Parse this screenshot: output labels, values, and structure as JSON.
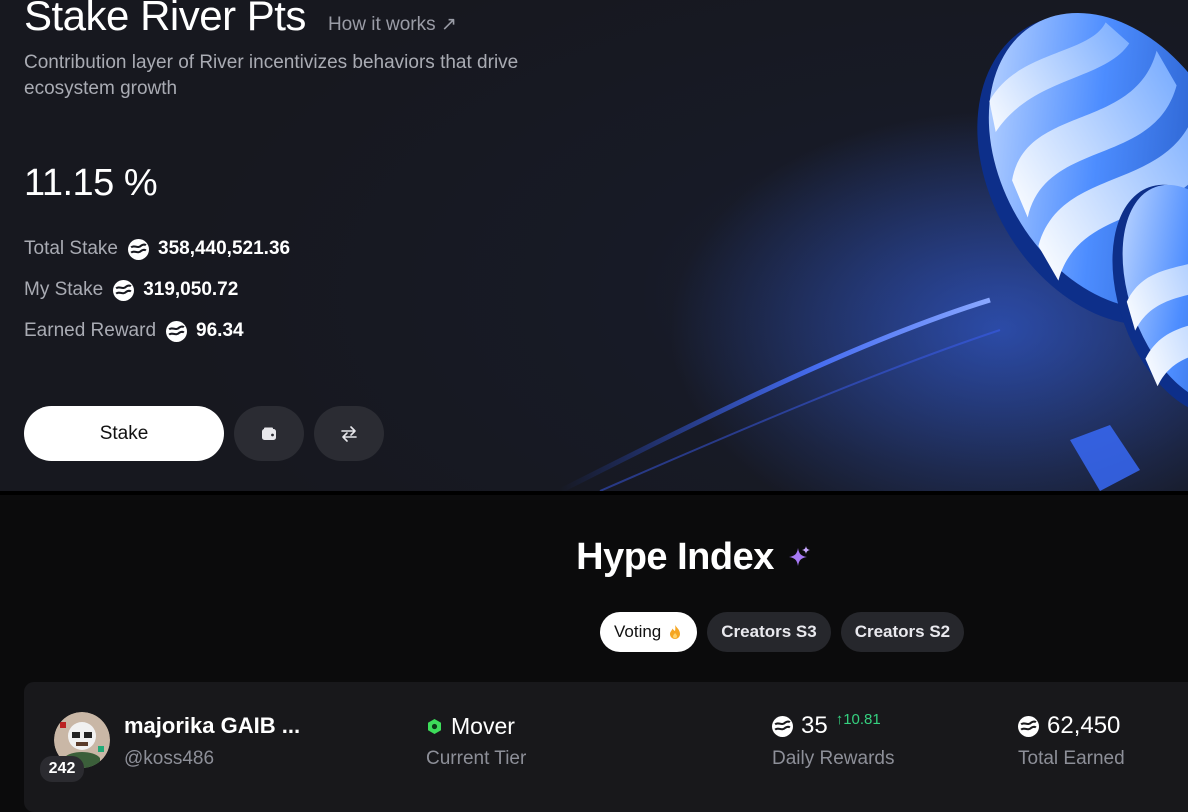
{
  "hero": {
    "title": "Stake River Pts",
    "how_it_works": "How it works ↗",
    "subtitle": "Contribution layer of River incentivizes behaviors that drive ecosystem growth",
    "apy": "11.15 %",
    "stats": [
      {
        "label": "Total Stake",
        "value": "358,440,521.36"
      },
      {
        "label": "My Stake",
        "value": "319,050.72"
      },
      {
        "label": "Earned Reward",
        "value": "96.34"
      }
    ],
    "stake_button": "Stake",
    "icons": {
      "coin": "river-coin-icon",
      "wallet": "wallet-icon",
      "swap": "swap-arrows-icon"
    }
  },
  "hype": {
    "title": "Hype Index",
    "sparkle_icon": "sparkle-icon",
    "tabs": [
      {
        "label": "Voting",
        "active": true,
        "icon": "fire-icon"
      },
      {
        "label": "Creators S3",
        "active": false
      },
      {
        "label": "Creators S2",
        "active": false
      }
    ],
    "entries": [
      {
        "rank": "242",
        "name": "majorika GAIB ...",
        "handle": "@koss486",
        "tier": "Mover",
        "tier_label": "Current Tier",
        "daily_rewards": "35",
        "daily_change": "↑10.81",
        "daily_label": "Daily Rewards",
        "total_earned": "62,450",
        "total_label": "Total Earned"
      }
    ]
  },
  "colors": {
    "hero_bg": "#17181f",
    "page_bg": "#0b0b0c",
    "accent_blue": "#3b7bff",
    "positive_green": "#35d07f",
    "tier_green": "#3ddc5a",
    "sparkle_purple": "#a779f5"
  }
}
